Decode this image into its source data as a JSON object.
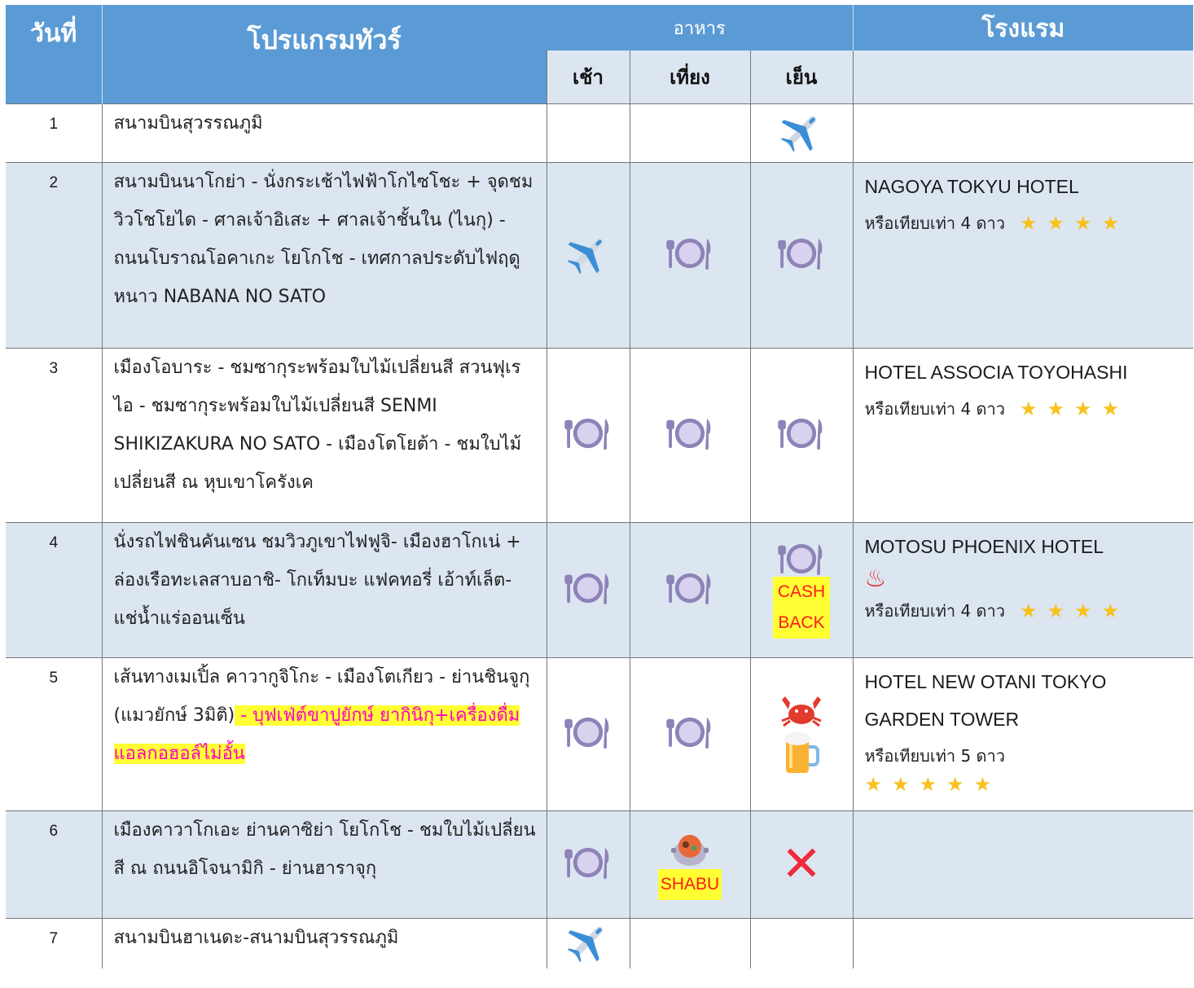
{
  "header": {
    "day": "วันที่",
    "program": "โปรแกรมทัวร์",
    "meals": "อาหาร",
    "breakfast": "เช้า",
    "lunch": "เที่ยง",
    "dinner": "เย็น",
    "hotel": "โรงแรม"
  },
  "rows": [
    {
      "day": "1",
      "program": "สนามบินสุวรรณภูมิ",
      "breakfast": "",
      "lunch": "",
      "dinner": "plane-icon",
      "hotel": "",
      "hotel_note": "",
      "stars": 0
    },
    {
      "day": "2",
      "program": "สนามบินนาโกย่า - นั่งกระเช้าไฟฟ้าโกไซโชะ + จุดชมวิวโชโยได - ศาลเจ้าอิเสะ + ศาลเจ้าชั้นใน (ไนกุ) - ถนนโบราณโอคาเกะ โยโกโช - เทศกาลประดับไฟฤดูหนาว NABANA NO SATO",
      "breakfast": "plane-icon",
      "lunch": "plate-icon",
      "dinner": "plate-icon",
      "hotel": "NAGOYA TOKYU HOTEL",
      "hotel_note": "หรือเทียบเท่า 4 ดาว",
      "stars": 4
    },
    {
      "day": "3",
      "program": "เมืองโอบาระ - ชมซากุระพร้อมใบไม้เปลี่ยนสี สวนฟุเรไอ - ชมซากุระพร้อมใบไม้เปลี่ยนสี SENMI SHIKIZAKURA NO SATO - เมืองโตโยต้า - ชมใบไม้เปลี่ยนสี ณ หุบเขาโครังเค",
      "breakfast": "plate-icon",
      "lunch": "plate-icon",
      "dinner": "plate-icon",
      "hotel": "HOTEL ASSOCIA TOYOHASHI",
      "hotel_note": "หรือเทียบเท่า 4 ดาว",
      "stars": 4
    },
    {
      "day": "4",
      "program": "นั่งรถไฟชินคันเซน ชมวิวภูเขาไฟฟูจิ- เมืองฮาโกเน่ + ล่องเรือทะเลสาบอาชิ- โกเท็มบะ แฟคทอรี่ เอ้าท์เล็ต- แช่น้ำแร่ออนเซ็น",
      "breakfast": "plate-icon",
      "lunch": "plate-icon",
      "dinner": "plate-icon",
      "dinner_badge": "CASH BACK",
      "hotel": "MOTOSU PHOENIX HOTEL",
      "hotel_note": "หรือเทียบเท่า 4 ดาว",
      "stars": 4
    },
    {
      "day": "5",
      "program": "เส้นทางเมเปิ้ล คาวากูจิโกะ - เมืองโตเกียว - ย่านชินจูกุ (แมวยักษ์ 3มิติ)",
      "program_highlight": " - บุฟเฟ่ต์ขาปูยักษ์ ยากินิกุ+เครื่องดื่มแอลกอฮอล์ไม่อั้น",
      "breakfast": "plate-icon",
      "lunch": "plate-icon",
      "dinner": "crab-icon",
      "hotel": "HOTEL NEW OTANI TOKYO GARDEN TOWER",
      "hotel_note": "หรือเทียบเท่า 5 ดาว",
      "stars": 5
    },
    {
      "day": "6",
      "program": "เมืองคาวาโกเอะ ย่านคาซิย่า โยโกโช - ชมใบไม้เปลี่ยนสี ณ ถนนอิโจนามิกิ - ย่านฮาราจุกุ",
      "breakfast": "plate-icon",
      "lunch": "shabu-pot-icon",
      "lunch_badge": "SHABU",
      "dinner": "cross-icon",
      "hotel": "",
      "hotel_note": "",
      "stars": 0
    },
    {
      "day": "7",
      "program": "สนามบินฮาเนดะ-สนามบินสุวรรณภูมิ",
      "breakfast": "plane-icon",
      "lunch": "",
      "dinner": "",
      "hotel": "",
      "hotel_note": "",
      "stars": 0
    }
  ],
  "colors": {
    "header_blue": "#5b9bd5",
    "row_blue": "#dce6f1",
    "highlight_yellow": "#ffff33",
    "highlight_text": "#ff00cc",
    "star": "#f8c21c"
  }
}
